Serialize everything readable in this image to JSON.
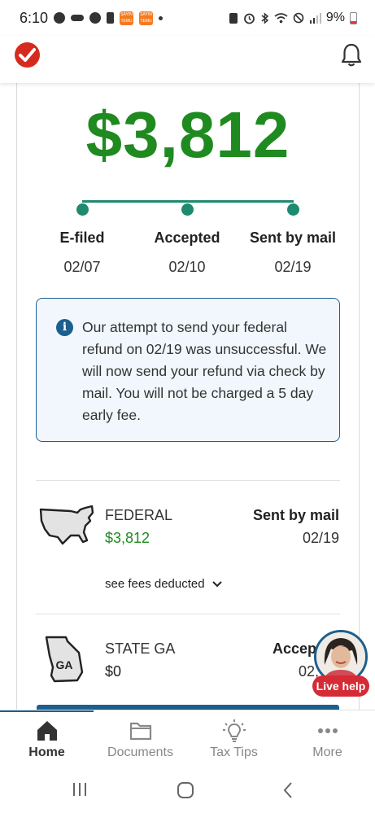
{
  "status_bar": {
    "time": "6:10",
    "battery": "9%",
    "app_icon_text": "ŞAYIN TEMU"
  },
  "header": {
    "logo": "turbotax-check-logo",
    "bell": "bell-icon"
  },
  "refund": {
    "amount": "$3,812"
  },
  "tracker": {
    "steps": [
      {
        "label": "E-filed",
        "date": "02/07"
      },
      {
        "label": "Accepted",
        "date": "02/10"
      },
      {
        "label": "Sent by mail",
        "date": "02/19"
      }
    ],
    "accent": "#1e8a70"
  },
  "info": {
    "icon": "info-icon",
    "message": "Our attempt to send your federal refund on 02/19 was unsuccessful. We will now send your refund via check by mail. You will not be charged a 5 day early fee."
  },
  "returns": [
    {
      "name": "FEDERAL",
      "amount": "$3,812",
      "status": "Sent by mail",
      "date": "02/19",
      "fees_link": "see fees deducted",
      "map": "usa-map"
    },
    {
      "name": "STATE GA",
      "amount": "$0",
      "status": "Accep",
      "date": "02,",
      "state_abbr": "GA",
      "map": "georgia-map"
    }
  ],
  "live_help": {
    "label": "Live help"
  },
  "bottom_nav": [
    {
      "label": "Home",
      "icon": "home-icon",
      "active": true
    },
    {
      "label": "Documents",
      "icon": "folder-icon",
      "active": false
    },
    {
      "label": "Tax Tips",
      "icon": "lightbulb-icon",
      "active": false
    },
    {
      "label": "More",
      "icon": "more-dots-icon",
      "active": false
    }
  ],
  "colors": {
    "green": "#1f8a1f",
    "blue": "#1c5f8f",
    "red": "#d52b1e"
  }
}
